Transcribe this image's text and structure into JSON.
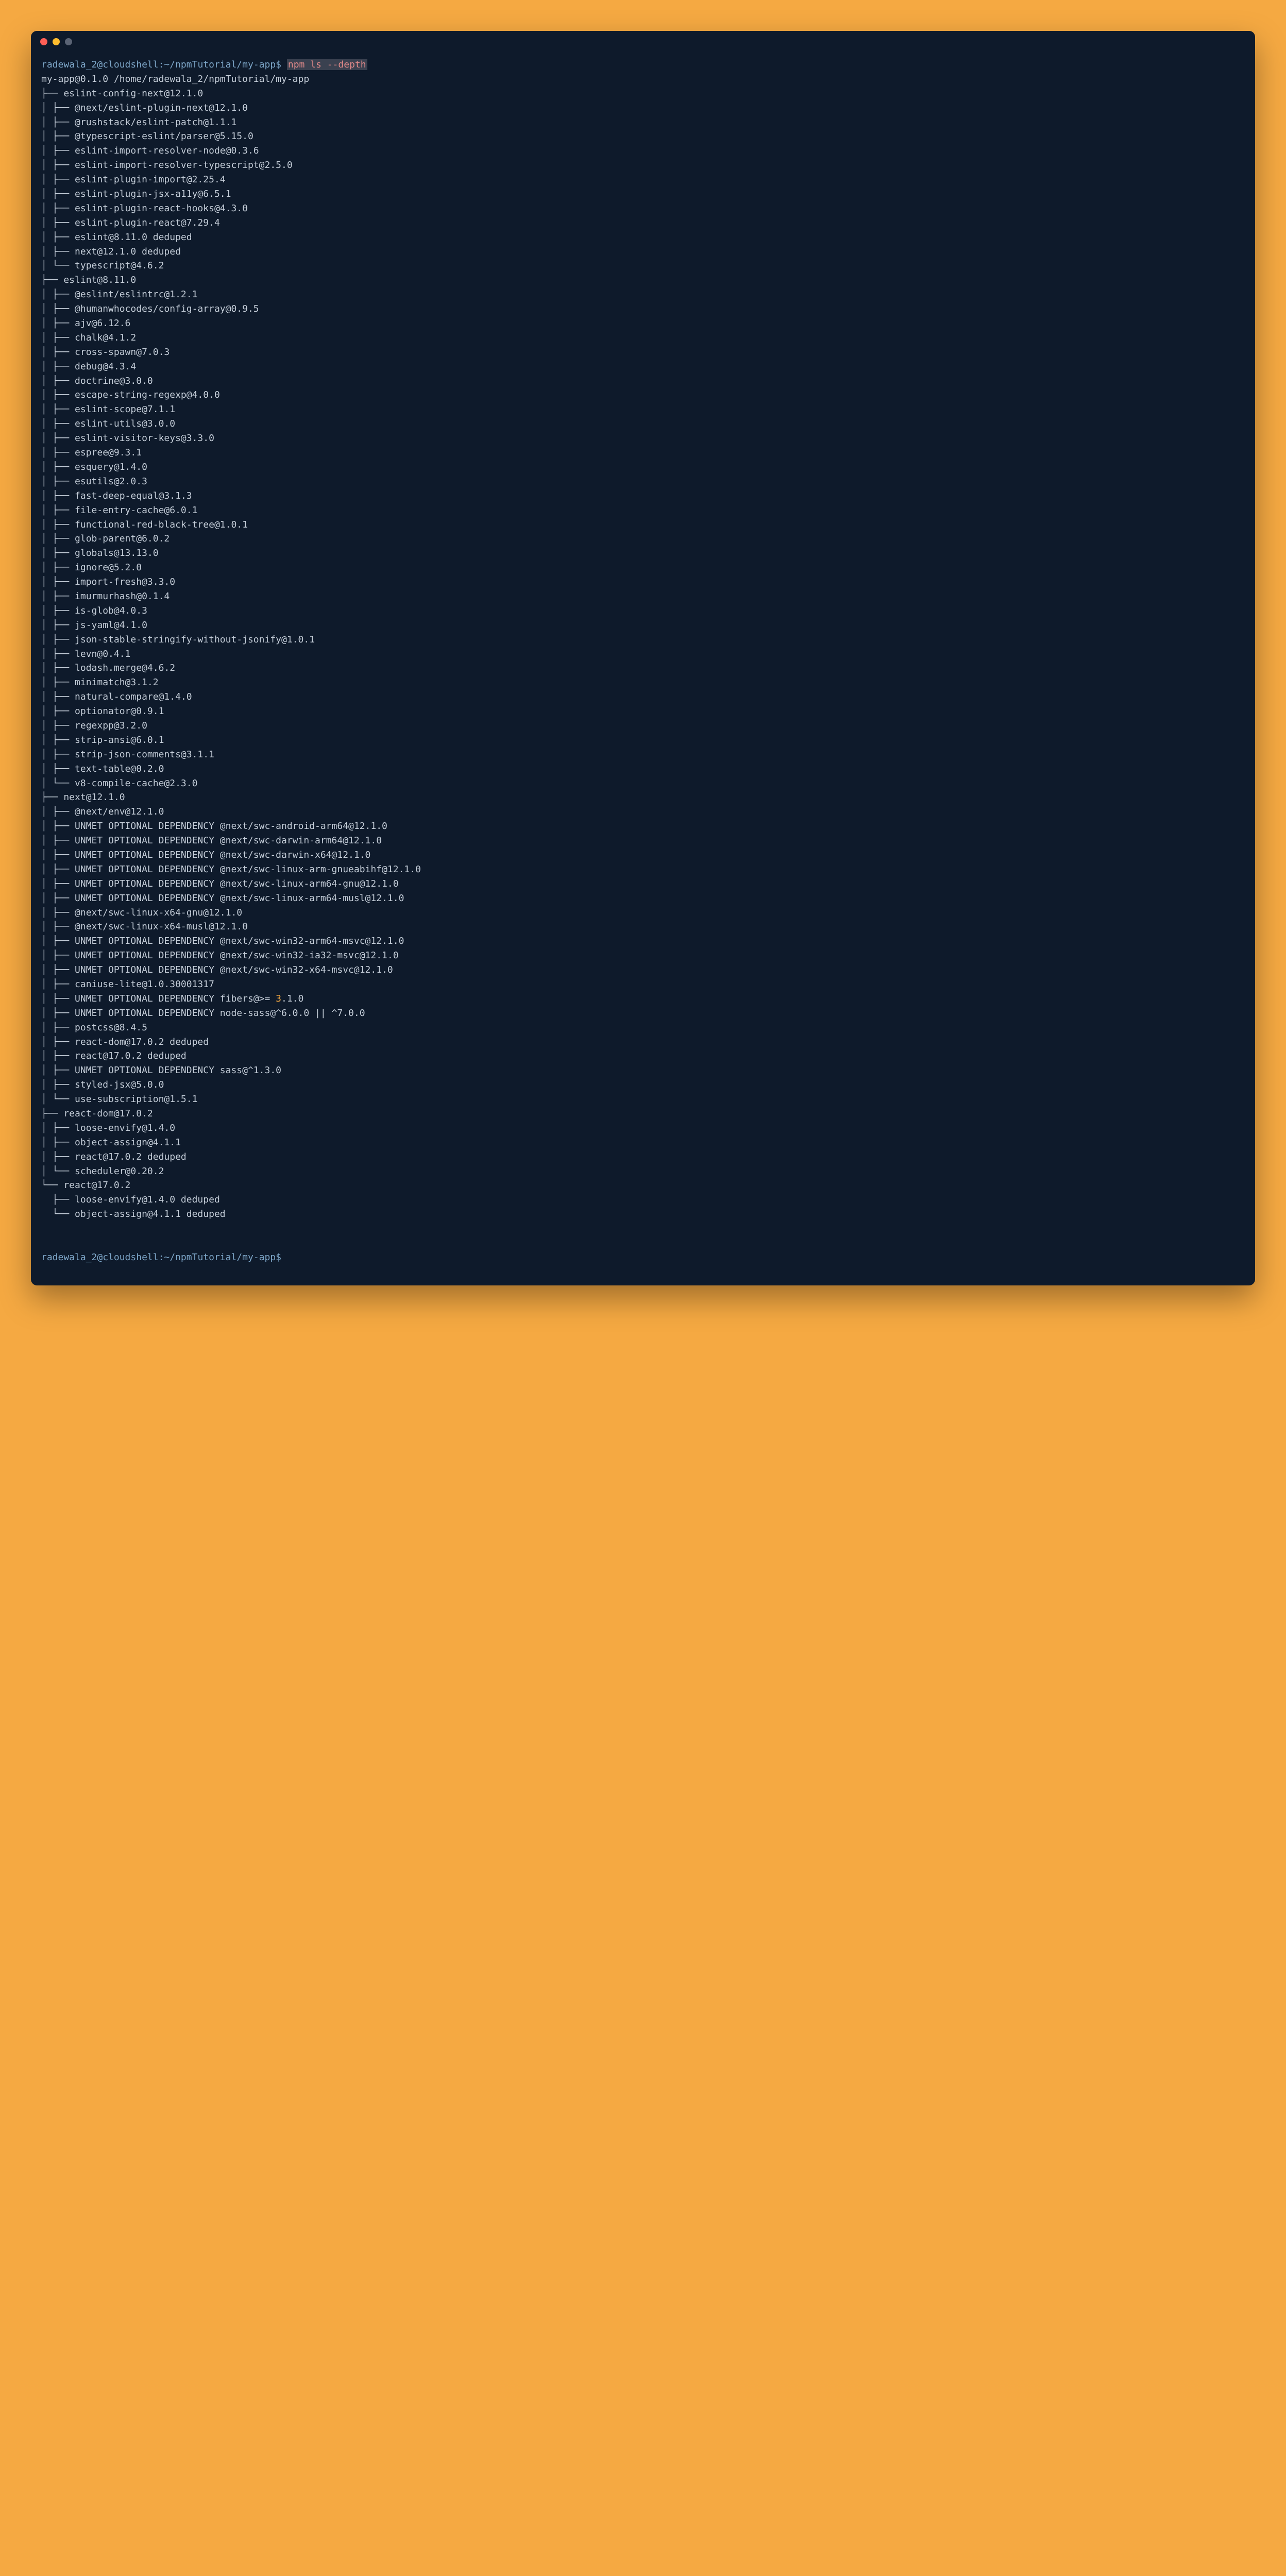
{
  "prompt1": {
    "user": "radewala_2@cloudshell",
    "sep": ":",
    "path": "~/npmTutorial/my-app",
    "sym": "$ ",
    "cmd": "npm ls --depth"
  },
  "header": "my-app@0.1.0 /home/radewala_2/npmTutorial/my-app",
  "lines": [
    "├── eslint-config-next@12.1.0",
    "│ ├── @next/eslint-plugin-next@12.1.0",
    "│ ├── @rushstack/eslint-patch@1.1.1",
    "│ ├── @typescript-eslint/parser@5.15.0",
    "│ ├── eslint-import-resolver-node@0.3.6",
    "│ ├── eslint-import-resolver-typescript@2.5.0",
    "│ ├── eslint-plugin-import@2.25.4",
    "│ ├── eslint-plugin-jsx-a11y@6.5.1",
    "│ ├── eslint-plugin-react-hooks@4.3.0",
    "│ ├── eslint-plugin-react@7.29.4",
    "│ ├── eslint@8.11.0 deduped",
    "│ ├── next@12.1.0 deduped",
    "│ └── typescript@4.6.2",
    "├── eslint@8.11.0",
    "│ ├── @eslint/eslintrc@1.2.1",
    "│ ├── @humanwhocodes/config-array@0.9.5",
    "│ ├── ajv@6.12.6",
    "│ ├── chalk@4.1.2",
    "│ ├── cross-spawn@7.0.3",
    "│ ├── debug@4.3.4",
    "│ ├── doctrine@3.0.0",
    "│ ├── escape-string-regexp@4.0.0",
    "│ ├── eslint-scope@7.1.1",
    "│ ├── eslint-utils@3.0.0",
    "│ ├── eslint-visitor-keys@3.3.0",
    "│ ├── espree@9.3.1",
    "│ ├── esquery@1.4.0",
    "│ ├── esutils@2.0.3",
    "│ ├── fast-deep-equal@3.1.3",
    "│ ├── file-entry-cache@6.0.1",
    "│ ├── functional-red-black-tree@1.0.1",
    "│ ├── glob-parent@6.0.2",
    "│ ├── globals@13.13.0",
    "│ ├── ignore@5.2.0",
    "│ ├── import-fresh@3.3.0",
    "│ ├── imurmurhash@0.1.4",
    "│ ├── is-glob@4.0.3",
    "│ ├── js-yaml@4.1.0",
    "│ ├── json-stable-stringify-without-jsonify@1.0.1",
    "│ ├── levn@0.4.1",
    "│ ├── lodash.merge@4.6.2",
    "│ ├── minimatch@3.1.2",
    "│ ├── natural-compare@1.4.0",
    "│ ├── optionator@0.9.1",
    "│ ├── regexpp@3.2.0",
    "│ ├── strip-ansi@6.0.1",
    "│ ├── strip-json-comments@3.1.1",
    "│ ├── text-table@0.2.0",
    "│ └── v8-compile-cache@2.3.0",
    "├── next@12.1.0",
    "│ ├── @next/env@12.1.0",
    "│ ├── UNMET OPTIONAL DEPENDENCY @next/swc-android-arm64@12.1.0",
    "│ ├── UNMET OPTIONAL DEPENDENCY @next/swc-darwin-arm64@12.1.0",
    "│ ├── UNMET OPTIONAL DEPENDENCY @next/swc-darwin-x64@12.1.0",
    "│ ├── UNMET OPTIONAL DEPENDENCY @next/swc-linux-arm-gnueabihf@12.1.0",
    "│ ├── UNMET OPTIONAL DEPENDENCY @next/swc-linux-arm64-gnu@12.1.0",
    "│ ├── UNMET OPTIONAL DEPENDENCY @next/swc-linux-arm64-musl@12.1.0",
    "│ ├── @next/swc-linux-x64-gnu@12.1.0",
    "│ ├── @next/swc-linux-x64-musl@12.1.0",
    "│ ├── UNMET OPTIONAL DEPENDENCY @next/swc-win32-arm64-msvc@12.1.0",
    "│ ├── UNMET OPTIONAL DEPENDENCY @next/swc-win32-ia32-msvc@12.1.0",
    "│ ├── UNMET OPTIONAL DEPENDENCY @next/swc-win32-x64-msvc@12.1.0",
    "│ ├── caniuse-lite@1.0.30001317",
    "│ ├── UNMET OPTIONAL DEPENDENCY node-sass@^6.0.0 || ^7.0.0",
    "│ ├── postcss@8.4.5",
    "│ ├── react-dom@17.0.2 deduped",
    "│ ├── react@17.0.2 deduped",
    "│ ├── UNMET OPTIONAL DEPENDENCY sass@^1.3.0",
    "│ ├── styled-jsx@5.0.0",
    "│ └── use-subscription@1.5.1",
    "├── react-dom@17.0.2",
    "│ ├── loose-envify@1.4.0",
    "│ ├── object-assign@4.1.1",
    "│ ├── react@17.0.2 deduped",
    "│ └── scheduler@0.20.2",
    "└── react@17.0.2",
    "  ├── loose-envify@1.4.0 deduped",
    "  └── object-assign@4.1.1 deduped"
  ],
  "fibers_line": {
    "prefix": "│ ├── UNMET OPTIONAL DEPENDENCY fibers@>= ",
    "orange": "3",
    "suffix": ".1.0"
  },
  "prompt2": {
    "user": "radewala_2@cloudshell",
    "sep": ":",
    "path": "~/npmTutorial/my-app",
    "sym": "$"
  }
}
